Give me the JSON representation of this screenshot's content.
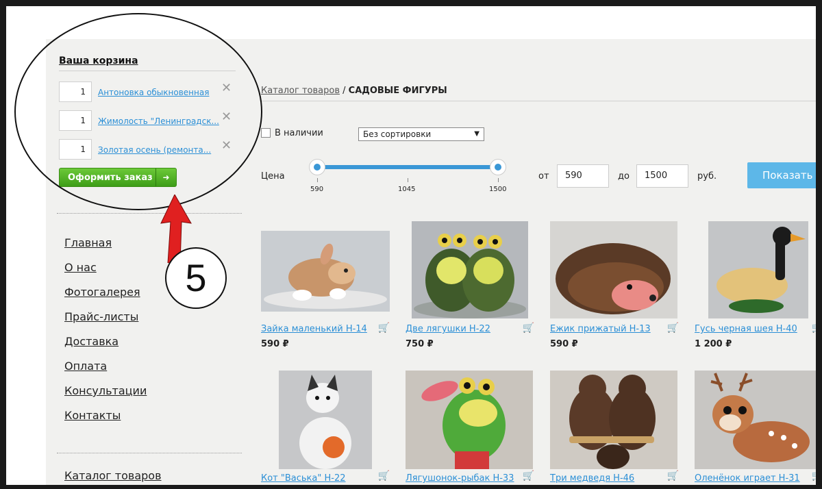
{
  "cart": {
    "title": "Ваша корзина",
    "items": [
      {
        "qty": "1",
        "name": "Антоновка обыкновенная"
      },
      {
        "qty": "1",
        "name": "Жимолость \"Ленинградск..."
      },
      {
        "qty": "1",
        "name": "Золотая осень (ремонта..."
      }
    ],
    "remove_glyph": "✕",
    "order_label": "Оформить заказ",
    "order_arrow": "➜"
  },
  "nav": {
    "items": [
      "Главная",
      "О нас",
      "Фотогалерея",
      "Прайс-листы",
      "Доставка",
      "Оплата",
      "Консультации",
      "Контакты"
    ],
    "catalog": "Каталог товаров"
  },
  "annotation": {
    "step": "5",
    "accent": "#e02020"
  },
  "breadcrumb": {
    "link": "Каталог товаров",
    "sep": "/",
    "current": "САДОВЫЕ ФИГУРЫ"
  },
  "filters": {
    "in_stock": "В наличии",
    "sort_value": "Без сортировки",
    "sort_caret": "▼",
    "price_label": "Цена",
    "ticks": [
      "590",
      "1045",
      "1500"
    ],
    "from_label": "от",
    "from_value": "590",
    "to_label": "до",
    "to_value": "1500",
    "currency": "руб.",
    "show_label": "Показать"
  },
  "products": [
    {
      "title": "Зайка маленький Н-14",
      "price": "590 ₽"
    },
    {
      "title": "Две лягушки Н-22",
      "price": "750 ₽"
    },
    {
      "title": "Ежик прижатый Н-13",
      "price": "590 ₽"
    },
    {
      "title": "Гусь черная шея Н-40",
      "price": "1 200 ₽"
    },
    {
      "title": "Кот \"Васька\" Н-22",
      "price": ""
    },
    {
      "title": "Лягушонок-рыбак Н-33",
      "price": ""
    },
    {
      "title": "Три медведя Н-46",
      "price": ""
    },
    {
      "title": "Оленёнок играет Н-31",
      "price": ""
    }
  ],
  "colors": {
    "link": "#2b8fd6",
    "order_button": "#4fb324",
    "show_button": "#5db7e8",
    "slider": "#3a97d6"
  },
  "icons": {
    "cart": "🛒"
  }
}
